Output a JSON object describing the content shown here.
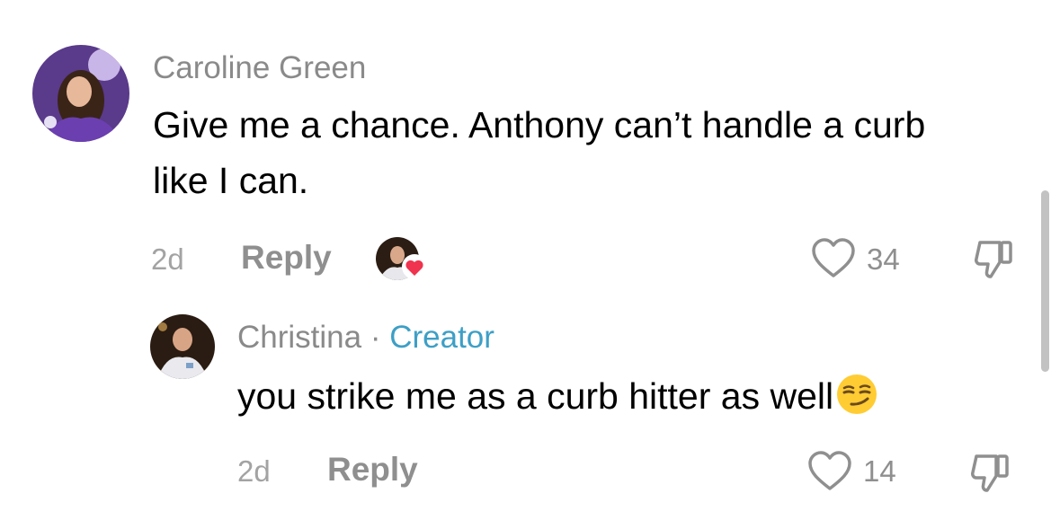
{
  "comments": [
    {
      "avatar_icon": "user-avatar-photo",
      "username": "Caroline Green",
      "text": "Give me a chance. Anthony can’t handle a curb like I can.",
      "time": "2d",
      "reply_label": "Reply",
      "liked_by_creator_icon": "creator-heart-avatar",
      "like_icon": "heart-outline-icon",
      "likes": "34",
      "dislike_icon": "thumbs-down-icon"
    },
    {
      "avatar_icon": "user-avatar-photo",
      "username": "Christina",
      "separator": " · ",
      "creator_label": "Creator",
      "text": "you strike me as a curb hitter as well",
      "emoji": "smirking-face-emoji",
      "time": "2d",
      "reply_label": "Reply",
      "like_icon": "heart-outline-icon",
      "likes": "14",
      "dislike_icon": "thumbs-down-icon"
    }
  ],
  "colors": {
    "username": "#8a8a8a",
    "creator": "#3d9fc6",
    "meta": "#8f8f8f",
    "heart_badge": "#f0334e"
  }
}
